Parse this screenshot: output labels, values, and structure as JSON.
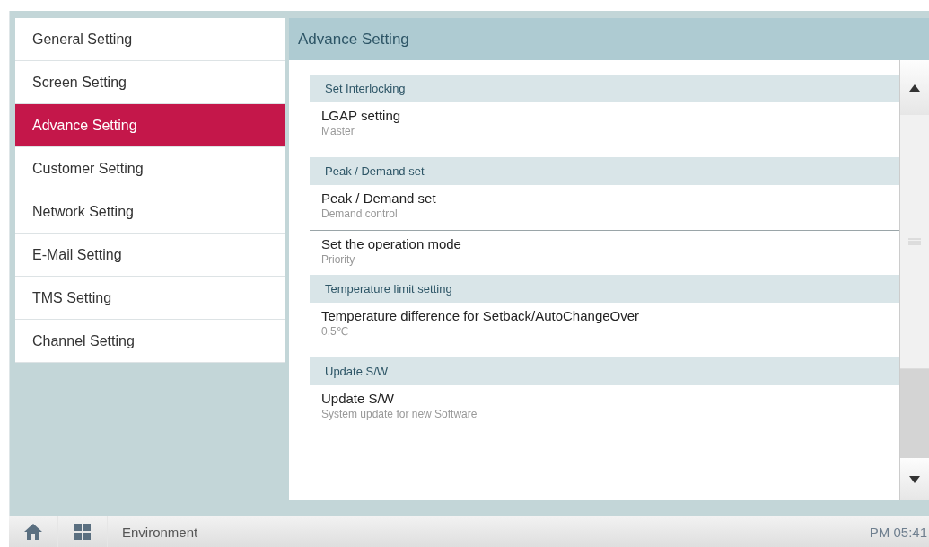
{
  "sidebar": {
    "items": [
      {
        "label": "General Setting",
        "selected": false
      },
      {
        "label": "Screen Setting",
        "selected": false
      },
      {
        "label": "Advance Setting",
        "selected": true
      },
      {
        "label": "Customer Setting",
        "selected": false
      },
      {
        "label": "Network Setting",
        "selected": false
      },
      {
        "label": "E-Mail Setting",
        "selected": false
      },
      {
        "label": "TMS Setting",
        "selected": false
      },
      {
        "label": "Channel Setting",
        "selected": false
      }
    ]
  },
  "panel": {
    "title": "Advance Setting",
    "sections": [
      {
        "header": "Set Interlocking",
        "items": [
          {
            "title": "LGAP setting",
            "value": "Master"
          }
        ]
      },
      {
        "header": "Peak / Demand set",
        "items": [
          {
            "title": "Peak / Demand set",
            "value": "Demand control"
          },
          {
            "title": "Set the operation mode",
            "value": "Priority"
          }
        ]
      },
      {
        "header": "Temperature limit setting",
        "items": [
          {
            "title": "Temperature difference for Setback/AutoChangeOver",
            "value": "0,5℃"
          }
        ]
      },
      {
        "header": "Update S/W",
        "items": [
          {
            "title": "Update S/W",
            "value": "System update for new Software"
          }
        ]
      }
    ]
  },
  "bottom_bar": {
    "label": "Environment",
    "time": "PM 05:41"
  }
}
